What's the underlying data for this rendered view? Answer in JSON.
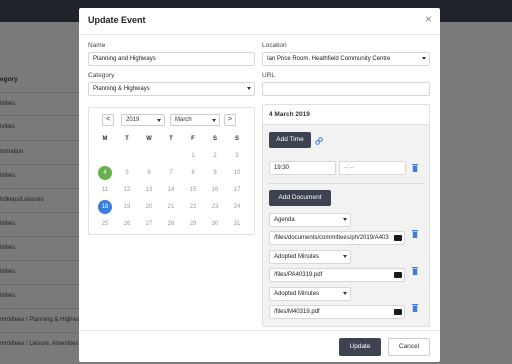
{
  "background": {
    "header": "egory",
    "rows": [
      "ivities",
      "ivities",
      "ormation",
      "ivities",
      "hdkeps/Leisures",
      "ivities",
      "ivities",
      "ivities",
      "ivities",
      "ivities",
      "mmittees / Planning & Highway",
      "mmittees / Leisure, Amenities a"
    ]
  },
  "modal": {
    "title": "Update Event",
    "close_glyph": "×",
    "name_label": "Name",
    "name_value": "Planning and Highways",
    "location_label": "Location",
    "location_value": "Ian Price Room, Heathfield Community Centre",
    "category_label": "Category",
    "category_value": "Planning & Highways",
    "url_label": "URL",
    "url_value": "",
    "update_label": "Update",
    "cancel_label": "Cancel"
  },
  "calendar": {
    "prev": "<",
    "next": ">",
    "year": "2019",
    "month": "March",
    "weekdays": [
      "M",
      "T",
      "W",
      "T",
      "F",
      "S",
      "S"
    ],
    "weeks": [
      [
        "",
        "",
        "",
        "",
        "1",
        "2",
        "3"
      ],
      [
        "4",
        "5",
        "6",
        "7",
        "8",
        "9",
        "10"
      ],
      [
        "11",
        "12",
        "13",
        "14",
        "15",
        "16",
        "17"
      ],
      [
        "18",
        "19",
        "20",
        "21",
        "22",
        "23",
        "24"
      ],
      [
        "25",
        "26",
        "27",
        "28",
        "29",
        "30",
        "31"
      ]
    ],
    "today": "4",
    "selected": "18"
  },
  "event": {
    "date_heading": "4 March 2019",
    "add_time_label": "Add Time",
    "time_start": "19:30",
    "time_end": "--:--",
    "add_document_label": "Add Document",
    "documents": [
      {
        "type": "Agenda",
        "path": "/files/documents/committees/ph/2019/A403"
      },
      {
        "type": "Adopted Minutes",
        "path": "/files/PA40319.pdf"
      },
      {
        "type": "Adopted Minutes",
        "path": "/files/M40319.pdf"
      }
    ]
  },
  "colors": {
    "accent_dark": "#3d4350",
    "today": "#6ab04c",
    "selected": "#3b7dd8",
    "trash": "#3b7dd8"
  }
}
